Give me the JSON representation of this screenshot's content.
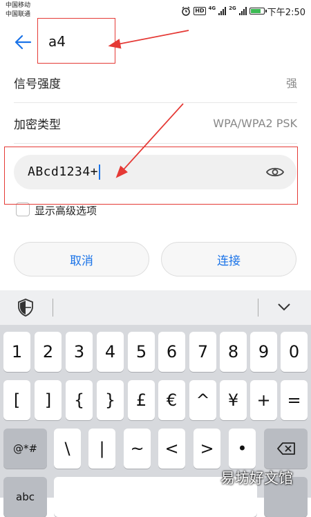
{
  "status_bar": {
    "carrier_1": "中国移动",
    "carrier_2": "中国联通",
    "hd": "HD",
    "net_1": "4G",
    "net_2": "2G",
    "time": "下午2:50"
  },
  "header": {
    "ssid": "a4"
  },
  "info_rows": [
    {
      "label": "信号强度",
      "value": "强"
    },
    {
      "label": "加密类型",
      "value": "WPA/WPA2 PSK"
    }
  ],
  "password": {
    "value": "ABcd1234+"
  },
  "advanced": {
    "label": "显示高级选项",
    "checked": false
  },
  "buttons": {
    "cancel": "取消",
    "connect": "连接"
  },
  "keyboard": {
    "row1": [
      "1",
      "2",
      "3",
      "4",
      "5",
      "6",
      "7",
      "8",
      "9",
      "0"
    ],
    "row2": [
      "[",
      "]",
      "{",
      "}",
      "£",
      "€",
      "^",
      "¥",
      "+",
      "="
    ],
    "row3_mode": "@*#",
    "row3": [
      "\\",
      "|",
      "~",
      "<",
      ">",
      "•"
    ],
    "row4_mode": "abc"
  },
  "watermark": "易坊好文馆",
  "colors": {
    "accent": "#1a73e8",
    "annotation": "#e53935"
  }
}
